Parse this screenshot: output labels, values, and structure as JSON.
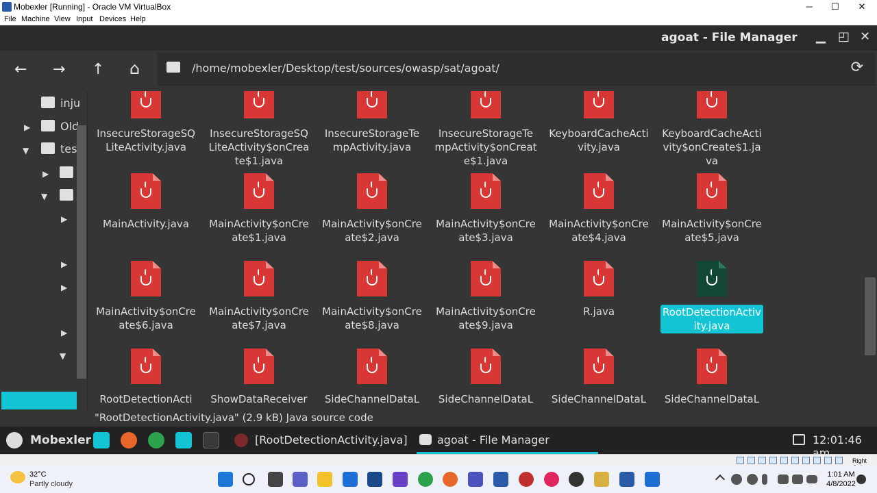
{
  "vbox": {
    "title": "Mobexler [Running] - Oracle VM VirtualBox",
    "menu": [
      "File",
      "Machine",
      "View",
      "Input",
      "Devices",
      "Help"
    ],
    "minimize": "─",
    "maximize": "☐",
    "close": "✕",
    "host_key": "Right Ctrl"
  },
  "fm": {
    "title": "agoat - File Manager",
    "path": "/home/mobexler/Desktop/test/sources/owasp/sat/agoat/",
    "nav": {
      "back": "←",
      "forward": "→",
      "up": "↑",
      "home": "⌂",
      "reload": "⟳"
    },
    "win_controls": {
      "minimize": "▁",
      "maximize": "◰",
      "close": "✕"
    },
    "sidebar": [
      {
        "label": "inju"
      },
      {
        "label": "Old"
      },
      {
        "label": "tes"
      }
    ],
    "files": [
      {
        "name": "InsecureStorageSQLiteActivity.java"
      },
      {
        "name": "InsecureStorageSQLiteActivity$onCreate$1.java"
      },
      {
        "name": "InsecureStorageTempActivity.java"
      },
      {
        "name": "InsecureStorageTempActivity$onCreate$1.java"
      },
      {
        "name": "KeyboardCacheActivity.java"
      },
      {
        "name": "KeyboardCacheActivity$onCreate$1.java"
      },
      {
        "name": "MainActivity.java"
      },
      {
        "name": "MainActivity$onCreate$1.java"
      },
      {
        "name": "MainActivity$onCreate$2.java"
      },
      {
        "name": "MainActivity$onCreate$3.java"
      },
      {
        "name": "MainActivity$onCreate$4.java"
      },
      {
        "name": "MainActivity$onCreate$5.java"
      },
      {
        "name": "MainActivity$onCreate$6.java"
      },
      {
        "name": "MainActivity$onCreate$7.java"
      },
      {
        "name": "MainActivity$onCreate$8.java"
      },
      {
        "name": "MainActivity$onCreate$9.java"
      },
      {
        "name": "R.java"
      },
      {
        "name": "RootDetectionActivity.java",
        "selected": true
      },
      {
        "name": "RootDetectionActi"
      },
      {
        "name": "ShowDataReceiver"
      },
      {
        "name": "SideChannelDataL"
      },
      {
        "name": "SideChannelDataL"
      },
      {
        "name": "SideChannelDataL"
      },
      {
        "name": "SideChannelDataL"
      }
    ],
    "status": "\"RootDetectionActivity.java\" (2.9 kB) Java source code"
  },
  "taskbar": {
    "brand": "Mobexler",
    "tasks": [
      "[RootDetectionActivity.java]",
      "agoat - File Manager"
    ],
    "clock": "12:01:46 am"
  },
  "windows": {
    "weather_temp": "32°C",
    "weather_desc": "Partly cloudy",
    "time": "1:01 AM",
    "date": "4/8/2022"
  },
  "colors": {
    "accent": "#12c4d4",
    "java_icon": "#d93636",
    "java_icon_selected": "#134836"
  }
}
